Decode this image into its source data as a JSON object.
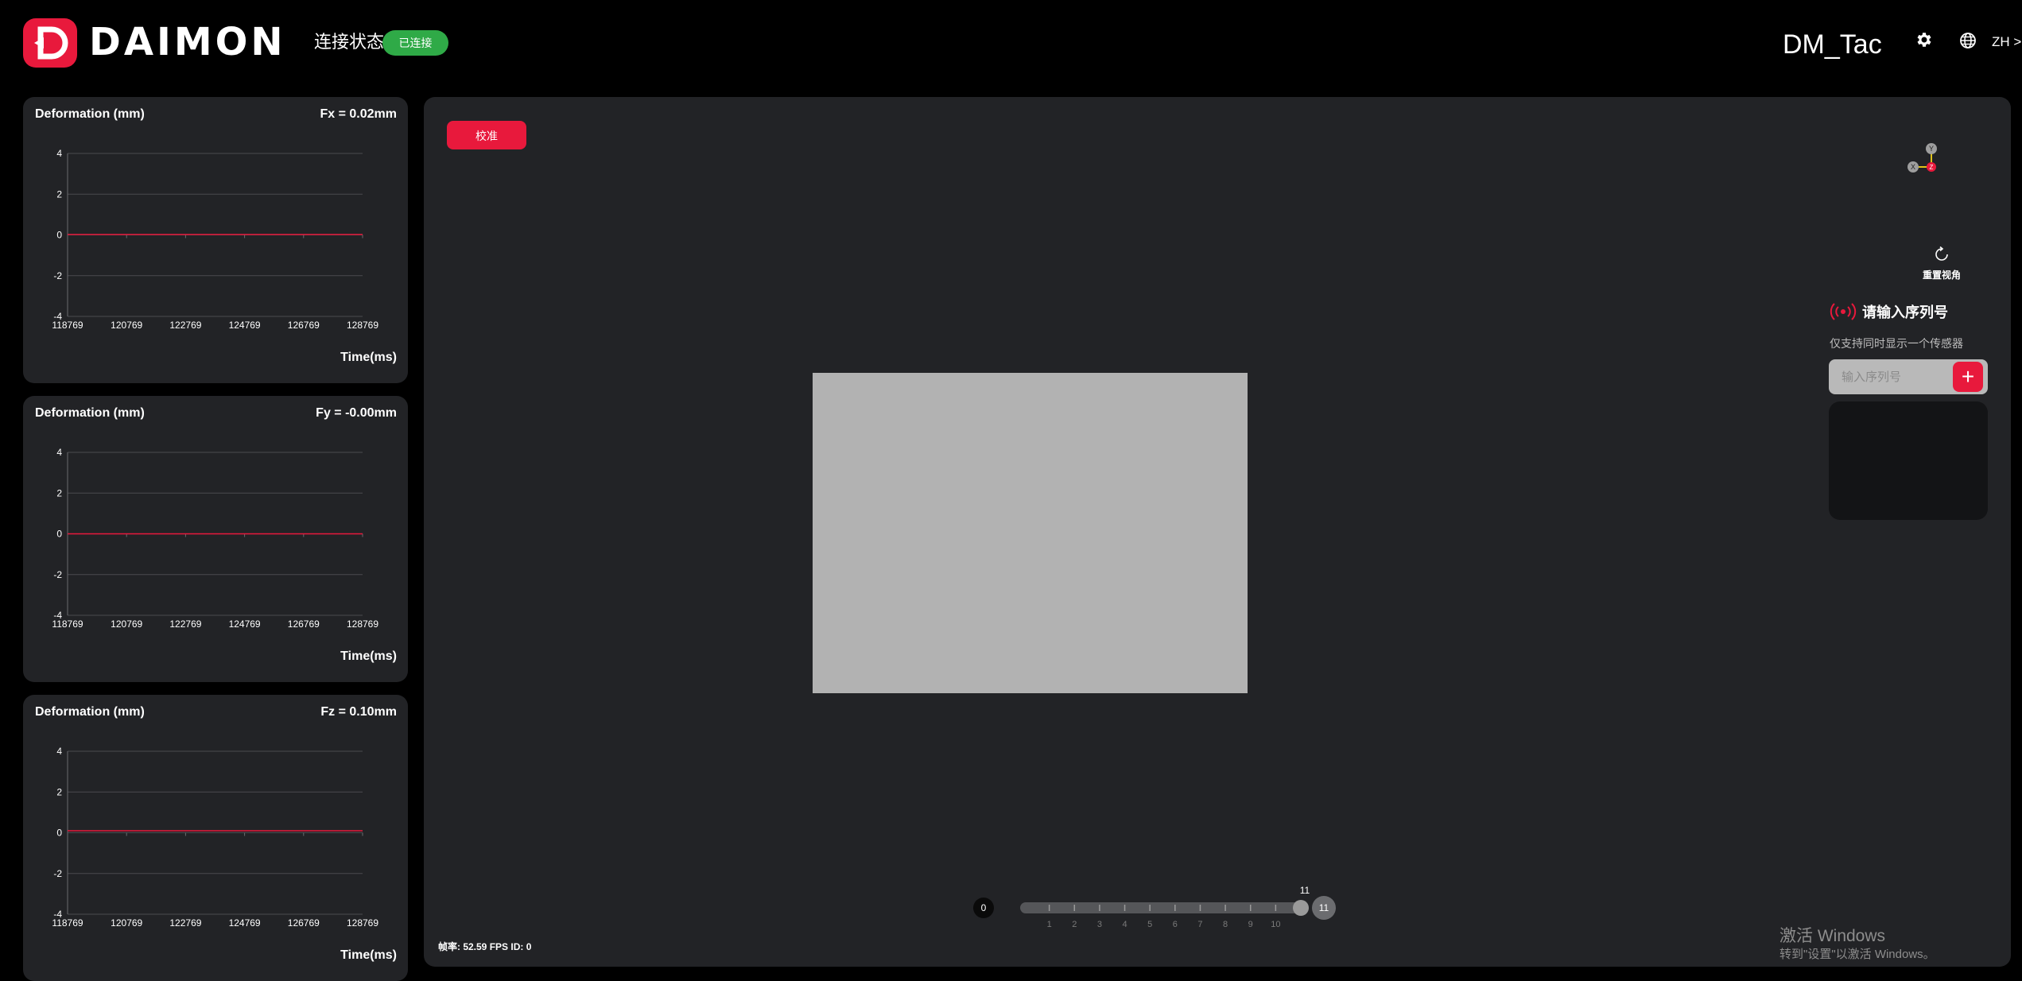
{
  "header": {
    "brand": "DAIMON",
    "connection_label": "连接状态:",
    "connection_status": "已连接",
    "connection_color": "#2faa47",
    "device_name": "DM_Tac",
    "settings_icon": "gear-icon",
    "language_icon": "globe-icon",
    "language": "ZH >"
  },
  "accent_color": "#e8193c",
  "charts": [
    {
      "title": "Deformation (mm)",
      "value_label": "Fx = 0.02mm",
      "xlabel": "Time(ms)"
    },
    {
      "title": "Deformation (mm)",
      "value_label": "Fy = -0.00mm",
      "xlabel": "Time(ms)"
    },
    {
      "title": "Deformation (mm)",
      "value_label": "Fz = 0.10mm",
      "xlabel": "Time(ms)"
    }
  ],
  "chart_data": [
    {
      "type": "line",
      "title": "Deformation (mm)",
      "xlabel": "Time(ms)",
      "ylabel": "",
      "x_ticks": [
        118769,
        120769,
        122769,
        124769,
        126769,
        128769
      ],
      "y_ticks": [
        4,
        2,
        0,
        -2,
        -4
      ],
      "xlim": [
        118769,
        128769
      ],
      "ylim": [
        -4,
        4
      ],
      "series": [
        {
          "x": [
            118769,
            128769
          ],
          "values": [
            0.02,
            0.02
          ],
          "color": "#e8193c"
        }
      ]
    },
    {
      "type": "line",
      "title": "Deformation (mm)",
      "xlabel": "Time(ms)",
      "ylabel": "",
      "x_ticks": [
        118769,
        120769,
        122769,
        124769,
        126769,
        128769
      ],
      "y_ticks": [
        4,
        2,
        0,
        -2,
        -4
      ],
      "xlim": [
        118769,
        128769
      ],
      "ylim": [
        -4,
        4
      ],
      "series": [
        {
          "x": [
            118769,
            128769
          ],
          "values": [
            0.0,
            0.0
          ],
          "color": "#e8193c"
        }
      ]
    },
    {
      "type": "line",
      "title": "Deformation (mm)",
      "xlabel": "Time(ms)",
      "ylabel": "",
      "x_ticks": [
        118769,
        120769,
        122769,
        124769,
        126769,
        128769
      ],
      "y_ticks": [
        4,
        2,
        0,
        -2,
        -4
      ],
      "xlim": [
        118769,
        128769
      ],
      "ylim": [
        -4,
        4
      ],
      "series": [
        {
          "x": [
            118769,
            128769
          ],
          "values": [
            0.1,
            0.1
          ],
          "color": "#e8193c"
        }
      ]
    }
  ],
  "main": {
    "calibrate_label": "校准",
    "axes": {
      "x": "X",
      "y": "Y",
      "z": "Z"
    },
    "reset_view_label": "重置视角",
    "serial": {
      "title": "请输入序列号",
      "hint": "仅支持同时显示一个传感器",
      "placeholder": "输入序列号",
      "add_label": "+"
    },
    "slider": {
      "min_label": "0",
      "max_label": "11",
      "value": 11,
      "value_label": "11",
      "ticks": [
        "1",
        "2",
        "3",
        "4",
        "5",
        "6",
        "7",
        "8",
        "9",
        "10"
      ]
    },
    "fps_info": "帧率: 52.59 FPS ID: 0"
  },
  "watermark": {
    "title": "激活 Windows",
    "subtitle": "转到\"设置\"以激活 Windows。"
  }
}
